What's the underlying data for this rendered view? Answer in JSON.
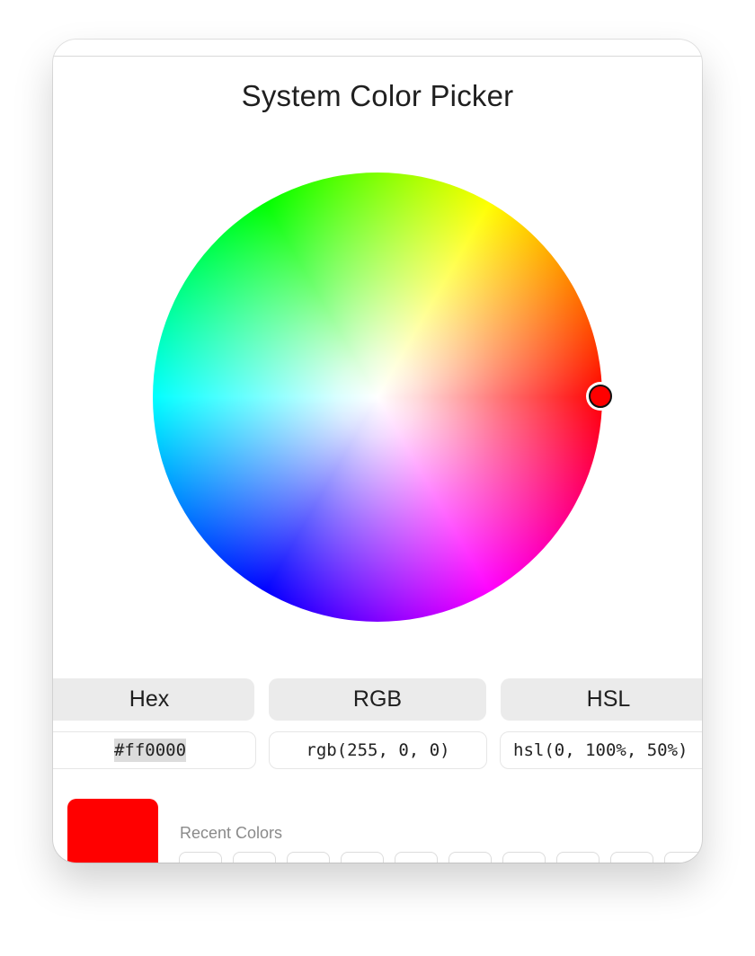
{
  "title": "System Color Picker",
  "selected_color": "#ff0000",
  "tabs": [
    {
      "label": "Hex"
    },
    {
      "label": "RGB"
    },
    {
      "label": "HSL"
    }
  ],
  "values": {
    "hex": "#ff0000",
    "rgb": "rgb(255, 0, 0)",
    "hsl": "hsl(0, 100%, 50%)"
  },
  "recent": {
    "label": "Recent Colors"
  }
}
